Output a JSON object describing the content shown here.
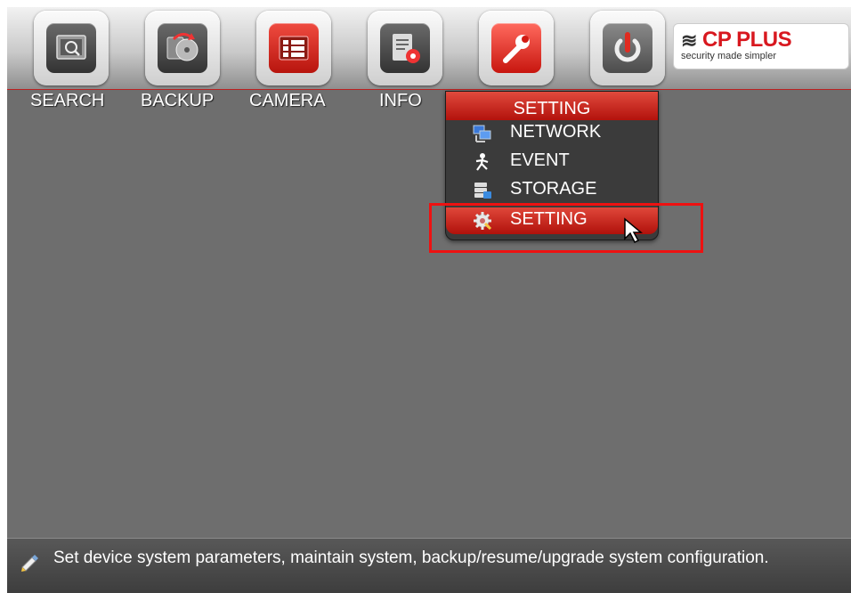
{
  "toolbar": {
    "items": [
      {
        "label": "SEARCH",
        "icon": "search-icon"
      },
      {
        "label": "BACKUP",
        "icon": "backup-icon"
      },
      {
        "label": "CAMERA",
        "icon": "camera-icon"
      },
      {
        "label": "INFO",
        "icon": "info-icon"
      },
      {
        "label": "SETTING",
        "icon": "wrench-icon",
        "active": true
      },
      {
        "label": "",
        "icon": "power-icon"
      }
    ]
  },
  "logo": {
    "brand": "CP PLUS",
    "tagline": "security made simpler",
    "accent_color": "#d8181f"
  },
  "dropdown": {
    "header": "SETTING",
    "items": [
      {
        "label": "NETWORK",
        "icon": "network-icon"
      },
      {
        "label": "EVENT",
        "icon": "event-icon"
      },
      {
        "label": "STORAGE",
        "icon": "storage-icon"
      },
      {
        "label": "SETTING",
        "icon": "gear-icon",
        "selected": true
      }
    ]
  },
  "status": {
    "text": "Set device system parameters, maintain system, backup/resume/upgrade system configuration.",
    "icon": "tip-icon"
  },
  "colors": {
    "accent": "#c8160f",
    "background": "#6e6e6e",
    "highlight_box": "#ee1111"
  }
}
